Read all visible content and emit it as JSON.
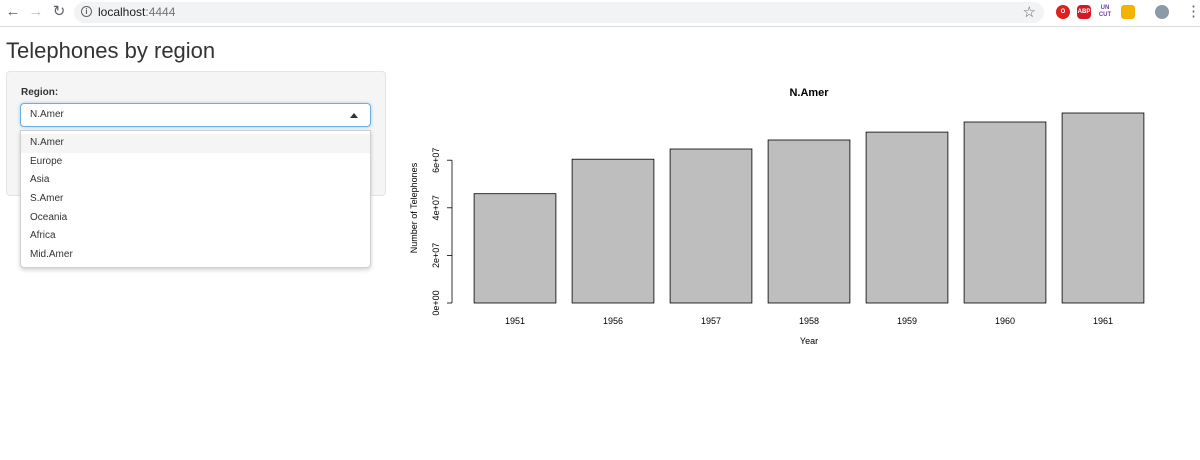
{
  "browser": {
    "url_host": "localhost",
    "url_port": ":4444",
    "extensions": [
      "opera-icon",
      "adblock-icon",
      "uncut-icon",
      "yellow-extension-icon",
      "avatar-icon"
    ]
  },
  "app": {
    "title": "Telephones by region"
  },
  "sidebar": {
    "region_label": "Region:",
    "select": {
      "value": "N.Amer",
      "options": [
        "N.Amer",
        "Europe",
        "Asia",
        "S.Amer",
        "Oceania",
        "Africa",
        "Mid.Amer"
      ]
    }
  },
  "chart_data": {
    "type": "bar",
    "title": "N.Amer",
    "xlabel": "Year",
    "ylabel": "Number of Telephones",
    "categories": [
      "1951",
      "1956",
      "1957",
      "1958",
      "1959",
      "1960",
      "1961"
    ],
    "values": [
      45939000,
      60423000,
      64721000,
      68484000,
      71799000,
      76036000,
      79831000
    ],
    "ylim": [
      0,
      80000000
    ],
    "yticks": [
      "0e+00",
      "2e+07",
      "4e+07",
      "6e+07"
    ],
    "ytick_values": [
      0,
      20000000,
      40000000,
      60000000
    ],
    "bar_color": "#bebebe",
    "grid": false,
    "legend": "none"
  }
}
